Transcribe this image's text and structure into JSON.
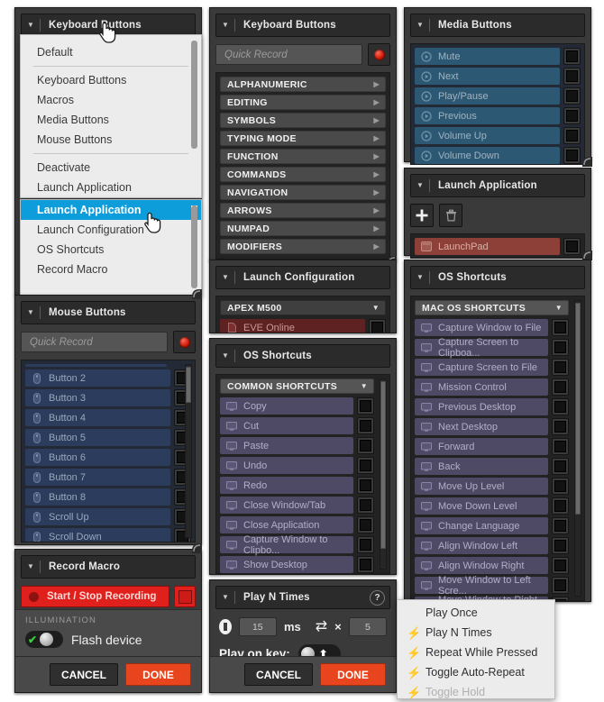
{
  "theme": {
    "accent_blue": "#0d9ddb",
    "accent_orange": "#e8451f",
    "record_red": "#e0201c",
    "panel_bg": "#3a3a3a",
    "media_row": "#2d5873",
    "mouse_row": "#2b3c5c",
    "shortcut_row": "#4e4a66",
    "app_row": "#8d4038"
  },
  "left_column": {
    "keyboard_panel": {
      "title": "Keyboard Buttons",
      "caret": "chevron-down-icon"
    },
    "dropdown_top": {
      "items": [
        "Default"
      ],
      "group2": [
        "Keyboard Buttons",
        "Macros",
        "Media Buttons",
        "Mouse Buttons"
      ],
      "group3": [
        "Deactivate",
        "Launch Application"
      ]
    },
    "dropdown_bottom": {
      "selected": "Launch Application",
      "items": [
        "Launch Application",
        "Launch Configuration",
        "OS Shortcuts",
        "Record Macro"
      ]
    },
    "mouse_panel": {
      "title": "Mouse Buttons",
      "quick_record_placeholder": "Quick Record",
      "record_button": "record-dot-icon",
      "items": [
        "Button 2",
        "Button 3",
        "Button 4",
        "Button 5",
        "Button 6",
        "Button 7",
        "Button 8",
        "Scroll Up",
        "Scroll Down"
      ]
    },
    "record_macro_panel": {
      "title": "Record Macro",
      "start_stop_label": "Start / Stop Recording",
      "illumination_label": "ILLUMINATION",
      "flash_device_label": "Flash device",
      "flash_device_enabled": true,
      "cancel_label": "CANCEL",
      "done_label": "DONE"
    }
  },
  "middle_column": {
    "keyboard_panel": {
      "title": "Keyboard Buttons",
      "quick_record_placeholder": "Quick Record",
      "record_button": "record-dot-icon",
      "categories": [
        "ALPHANUMERIC",
        "EDITING",
        "SYMBOLS",
        "TYPING MODE",
        "FUNCTION",
        "COMMANDS",
        "NAVIGATION",
        "ARROWS",
        "NUMPAD",
        "MODIFIERS"
      ]
    },
    "launch_config_panel": {
      "title": "Launch Configuration",
      "device_select": "APEX M500",
      "items": [
        "EVE Online"
      ]
    },
    "os_shortcuts_panel": {
      "title": "OS Shortcuts",
      "group_select": "COMMON SHORTCUTS",
      "items": [
        "Copy",
        "Cut",
        "Paste",
        "Undo",
        "Redo",
        "Close Window/Tab",
        "Close Application",
        "Capture Window to Clipbo...",
        "Show Desktop"
      ]
    },
    "play_n_times_panel": {
      "title": "Play N Times",
      "help_label": "?",
      "delay_value": "15",
      "delay_unit": "ms",
      "repeat_symbol": "×",
      "repeat_value": "5",
      "play_on_key_label": "Play on key:",
      "play_on_key_state": "up",
      "cancel_label": "CANCEL",
      "done_label": "DONE"
    }
  },
  "right_column": {
    "media_panel": {
      "title": "Media Buttons",
      "items": [
        "Mute",
        "Next",
        "Play/Pause",
        "Previous",
        "Volume Up",
        "Volume Down"
      ]
    },
    "launch_app_panel": {
      "title": "Launch Application",
      "add_button": "plus-icon",
      "delete_button": "trash-icon",
      "items": [
        "LaunchPad"
      ]
    },
    "os_shortcuts_panel": {
      "title": "OS Shortcuts",
      "group_select": "MAC OS SHORTCUTS",
      "items": [
        "Capture Window to File",
        "Capture Screen to Clipboa...",
        "Capture Screen to File",
        "Mission Control",
        "Previous Desktop",
        "Next Desktop",
        "Forward",
        "Back",
        "Move Up Level",
        "Move Down Level",
        "Change Language",
        "Align Window Left",
        "Align Window Right",
        "Move Window to Left Scre...",
        "Move Window to Right Scr..."
      ]
    }
  },
  "context_menu": {
    "items": [
      {
        "label": "Play Once",
        "icon": false,
        "disabled": false
      },
      {
        "label": "Play N Times",
        "icon": true,
        "disabled": false
      },
      {
        "label": "Repeat While Pressed",
        "icon": true,
        "disabled": false
      },
      {
        "label": "Toggle Auto-Repeat",
        "icon": true,
        "disabled": false
      },
      {
        "label": "Toggle Hold",
        "icon": true,
        "disabled": true
      }
    ]
  }
}
